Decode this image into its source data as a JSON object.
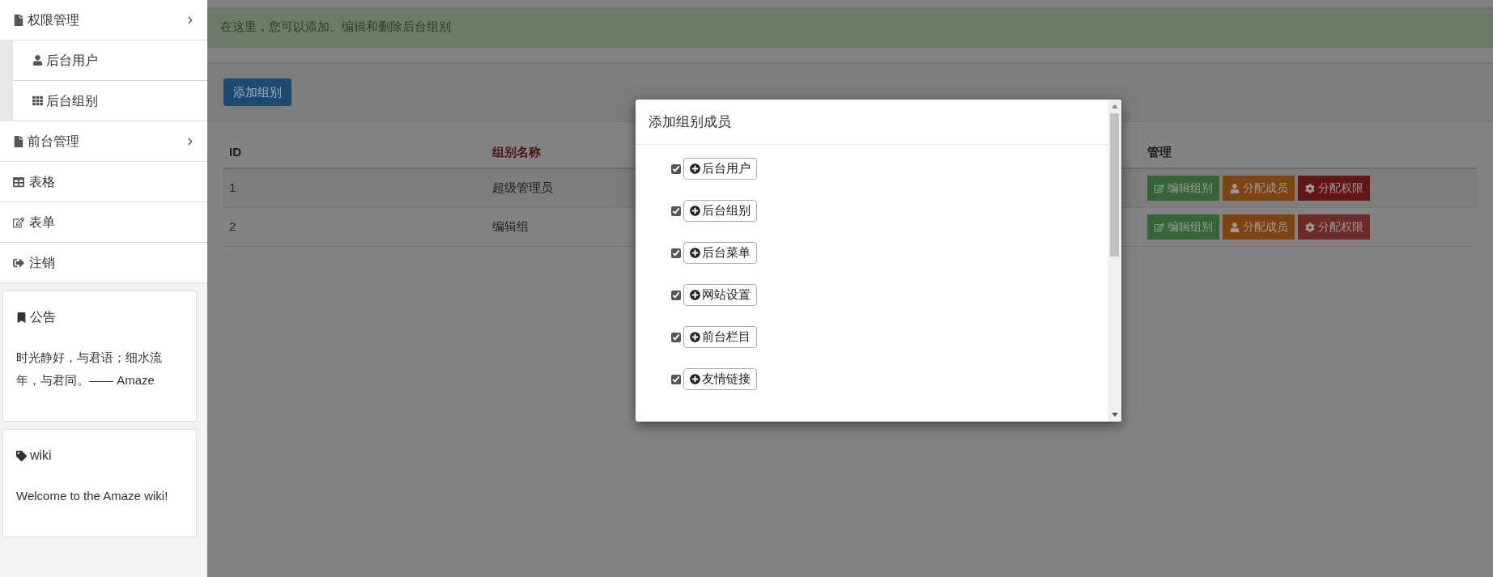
{
  "sidebar": {
    "items": [
      {
        "label": "权限管理",
        "kind": "group",
        "expanded": true,
        "children": [
          {
            "label": "后台用户"
          },
          {
            "label": "后台组别"
          }
        ]
      },
      {
        "label": "前台管理",
        "kind": "group",
        "expanded": false
      },
      {
        "label": "表格",
        "kind": "link"
      },
      {
        "label": "表单",
        "kind": "link"
      },
      {
        "label": "注销",
        "kind": "link"
      }
    ],
    "panels": [
      {
        "title": "公告",
        "body": "时光静好，与君语；细水流年，与君同。—— Amaze"
      },
      {
        "title": "wiki",
        "body": "Welcome to the Amaze wiki!"
      }
    ]
  },
  "alert": "在这里，您可以添加、编辑和删除后台组别",
  "add_button": "添加组别",
  "table": {
    "columns": [
      "ID",
      "组别名称",
      "管理"
    ],
    "rows": [
      {
        "id": "1",
        "name": "超级管理员",
        "actions": [
          {
            "kind": "edit",
            "label": "编辑组别",
            "active": false
          },
          {
            "kind": "members",
            "label": "分配成员",
            "active": false
          },
          {
            "kind": "permissions",
            "label": "分配权限",
            "active": true
          }
        ]
      },
      {
        "id": "2",
        "name": "编辑组",
        "actions": [
          {
            "kind": "edit",
            "label": "编辑组别",
            "active": false
          },
          {
            "kind": "members",
            "label": "分配成员",
            "active": false
          },
          {
            "kind": "permissions",
            "label": "分配权限",
            "active": false
          }
        ]
      }
    ]
  },
  "modal": {
    "title": "添加组别成员",
    "items": [
      {
        "label": "后台用户",
        "checked": true
      },
      {
        "label": "后台组别",
        "checked": true
      },
      {
        "label": "后台菜单",
        "checked": true
      },
      {
        "label": "网站设置",
        "checked": true
      },
      {
        "label": "前台栏目",
        "checked": true
      },
      {
        "label": "友情链接",
        "checked": true
      }
    ]
  }
}
